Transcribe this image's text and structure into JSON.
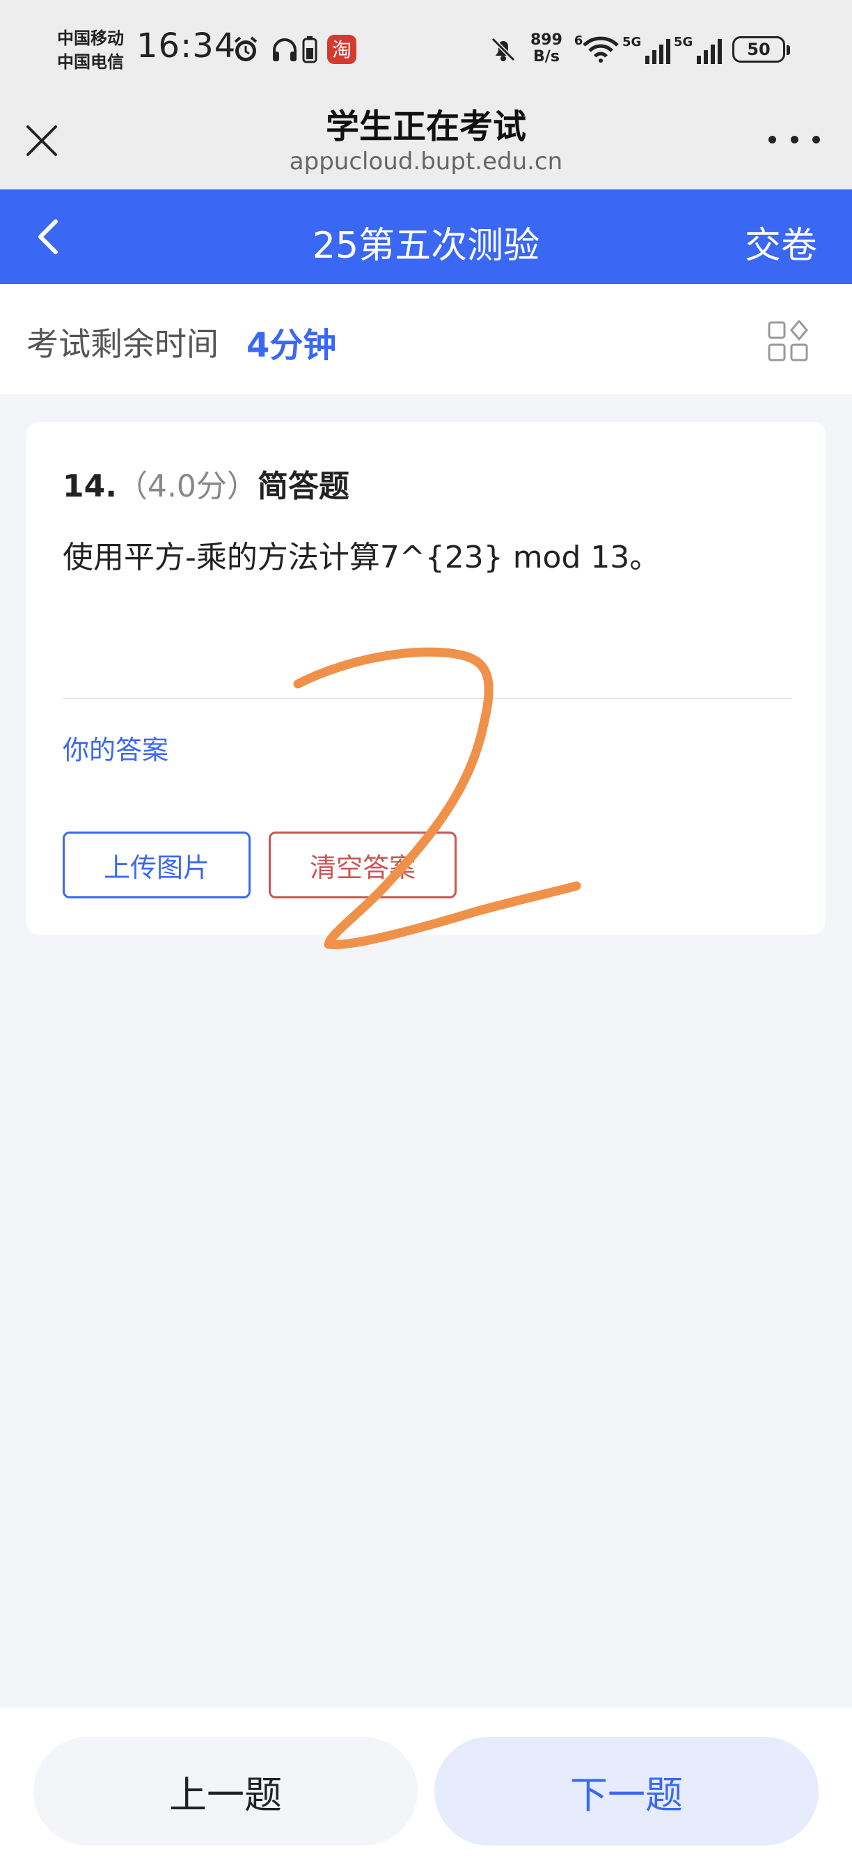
{
  "status_bar": {
    "carrier_1": "中国移动",
    "carrier_2": "中国电信",
    "time": "16:34",
    "app_badge": "淘",
    "net_speed_value": "899",
    "net_speed_unit": "B/s",
    "wifi_tag": "6",
    "signal_1_tag": "5G",
    "signal_2_tag": "5G",
    "battery": "50",
    "icons": [
      "alarm-icon",
      "headphones-icon",
      "battery-small-icon",
      "taobao-icon",
      "bell-off-icon",
      "wifi-icon",
      "signal-icon",
      "signal-icon",
      "battery-icon"
    ]
  },
  "browser": {
    "title": "学生正在考试",
    "url": "appucloud.bupt.edu.cn",
    "icons": [
      "close-icon",
      "more-icon"
    ]
  },
  "app_header": {
    "title": "25第五次测验",
    "submit_label": "交卷",
    "background": "#3a68f4",
    "icons": [
      "back-icon"
    ]
  },
  "timer": {
    "label": "考试剩余时间",
    "value": "4分钟",
    "icons": [
      "question-grid-icon"
    ]
  },
  "question": {
    "number": "14.",
    "score": "（4.0分）",
    "type": "简答题",
    "text": "使用平方-乘的方法计算7^{23} mod 13。",
    "answer_label": "你的答案",
    "upload_label": "上传图片",
    "clear_label": "清空答案"
  },
  "annotation": {
    "handwritten": "2",
    "color": "#f0914a"
  },
  "navigation": {
    "prev_label": "上一题",
    "next_label": "下一题"
  },
  "colors": {
    "accent": "#3a68f4",
    "danger": "#c95656",
    "page_background": "#f4f5f9"
  }
}
